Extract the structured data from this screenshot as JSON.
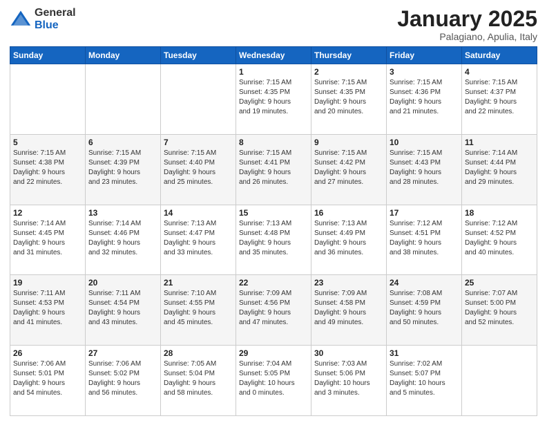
{
  "header": {
    "logo": {
      "general": "General",
      "blue": "Blue"
    },
    "title": "January 2025",
    "location": "Palagiano, Apulia, Italy"
  },
  "days_of_week": [
    "Sunday",
    "Monday",
    "Tuesday",
    "Wednesday",
    "Thursday",
    "Friday",
    "Saturday"
  ],
  "weeks": [
    [
      {
        "day": "",
        "info": ""
      },
      {
        "day": "",
        "info": ""
      },
      {
        "day": "",
        "info": ""
      },
      {
        "day": "1",
        "info": "Sunrise: 7:15 AM\nSunset: 4:35 PM\nDaylight: 9 hours\nand 19 minutes."
      },
      {
        "day": "2",
        "info": "Sunrise: 7:15 AM\nSunset: 4:35 PM\nDaylight: 9 hours\nand 20 minutes."
      },
      {
        "day": "3",
        "info": "Sunrise: 7:15 AM\nSunset: 4:36 PM\nDaylight: 9 hours\nand 21 minutes."
      },
      {
        "day": "4",
        "info": "Sunrise: 7:15 AM\nSunset: 4:37 PM\nDaylight: 9 hours\nand 22 minutes."
      }
    ],
    [
      {
        "day": "5",
        "info": "Sunrise: 7:15 AM\nSunset: 4:38 PM\nDaylight: 9 hours\nand 22 minutes."
      },
      {
        "day": "6",
        "info": "Sunrise: 7:15 AM\nSunset: 4:39 PM\nDaylight: 9 hours\nand 23 minutes."
      },
      {
        "day": "7",
        "info": "Sunrise: 7:15 AM\nSunset: 4:40 PM\nDaylight: 9 hours\nand 25 minutes."
      },
      {
        "day": "8",
        "info": "Sunrise: 7:15 AM\nSunset: 4:41 PM\nDaylight: 9 hours\nand 26 minutes."
      },
      {
        "day": "9",
        "info": "Sunrise: 7:15 AM\nSunset: 4:42 PM\nDaylight: 9 hours\nand 27 minutes."
      },
      {
        "day": "10",
        "info": "Sunrise: 7:15 AM\nSunset: 4:43 PM\nDaylight: 9 hours\nand 28 minutes."
      },
      {
        "day": "11",
        "info": "Sunrise: 7:14 AM\nSunset: 4:44 PM\nDaylight: 9 hours\nand 29 minutes."
      }
    ],
    [
      {
        "day": "12",
        "info": "Sunrise: 7:14 AM\nSunset: 4:45 PM\nDaylight: 9 hours\nand 31 minutes."
      },
      {
        "day": "13",
        "info": "Sunrise: 7:14 AM\nSunset: 4:46 PM\nDaylight: 9 hours\nand 32 minutes."
      },
      {
        "day": "14",
        "info": "Sunrise: 7:13 AM\nSunset: 4:47 PM\nDaylight: 9 hours\nand 33 minutes."
      },
      {
        "day": "15",
        "info": "Sunrise: 7:13 AM\nSunset: 4:48 PM\nDaylight: 9 hours\nand 35 minutes."
      },
      {
        "day": "16",
        "info": "Sunrise: 7:13 AM\nSunset: 4:49 PM\nDaylight: 9 hours\nand 36 minutes."
      },
      {
        "day": "17",
        "info": "Sunrise: 7:12 AM\nSunset: 4:51 PM\nDaylight: 9 hours\nand 38 minutes."
      },
      {
        "day": "18",
        "info": "Sunrise: 7:12 AM\nSunset: 4:52 PM\nDaylight: 9 hours\nand 40 minutes."
      }
    ],
    [
      {
        "day": "19",
        "info": "Sunrise: 7:11 AM\nSunset: 4:53 PM\nDaylight: 9 hours\nand 41 minutes."
      },
      {
        "day": "20",
        "info": "Sunrise: 7:11 AM\nSunset: 4:54 PM\nDaylight: 9 hours\nand 43 minutes."
      },
      {
        "day": "21",
        "info": "Sunrise: 7:10 AM\nSunset: 4:55 PM\nDaylight: 9 hours\nand 45 minutes."
      },
      {
        "day": "22",
        "info": "Sunrise: 7:09 AM\nSunset: 4:56 PM\nDaylight: 9 hours\nand 47 minutes."
      },
      {
        "day": "23",
        "info": "Sunrise: 7:09 AM\nSunset: 4:58 PM\nDaylight: 9 hours\nand 49 minutes."
      },
      {
        "day": "24",
        "info": "Sunrise: 7:08 AM\nSunset: 4:59 PM\nDaylight: 9 hours\nand 50 minutes."
      },
      {
        "day": "25",
        "info": "Sunrise: 7:07 AM\nSunset: 5:00 PM\nDaylight: 9 hours\nand 52 minutes."
      }
    ],
    [
      {
        "day": "26",
        "info": "Sunrise: 7:06 AM\nSunset: 5:01 PM\nDaylight: 9 hours\nand 54 minutes."
      },
      {
        "day": "27",
        "info": "Sunrise: 7:06 AM\nSunset: 5:02 PM\nDaylight: 9 hours\nand 56 minutes."
      },
      {
        "day": "28",
        "info": "Sunrise: 7:05 AM\nSunset: 5:04 PM\nDaylight: 9 hours\nand 58 minutes."
      },
      {
        "day": "29",
        "info": "Sunrise: 7:04 AM\nSunset: 5:05 PM\nDaylight: 10 hours\nand 0 minutes."
      },
      {
        "day": "30",
        "info": "Sunrise: 7:03 AM\nSunset: 5:06 PM\nDaylight: 10 hours\nand 3 minutes."
      },
      {
        "day": "31",
        "info": "Sunrise: 7:02 AM\nSunset: 5:07 PM\nDaylight: 10 hours\nand 5 minutes."
      },
      {
        "day": "",
        "info": ""
      }
    ]
  ]
}
